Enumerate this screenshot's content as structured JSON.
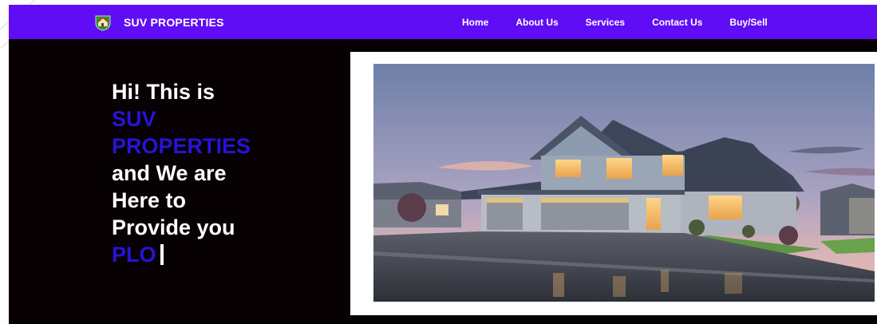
{
  "brand": {
    "name": "SUV PROPERTIES",
    "logo_icon": "house-badge-icon"
  },
  "nav": {
    "items": [
      {
        "label": "Home"
      },
      {
        "label": "About Us"
      },
      {
        "label": "Services"
      },
      {
        "label": "Contact Us"
      },
      {
        "label": "Buy/Sell"
      }
    ]
  },
  "hero": {
    "line1": "Hi! This is",
    "line2": "SUV",
    "line3": "PROPERTIES",
    "line4": "and We are",
    "line5": "Here to",
    "line6": "Provide you",
    "typed_word": "PLO",
    "image_icon": "house-photo"
  },
  "colors": {
    "nav_background": "#5f0df5",
    "page_background": "#070103",
    "accent_text": "#2713d8",
    "text": "#ffffff"
  }
}
